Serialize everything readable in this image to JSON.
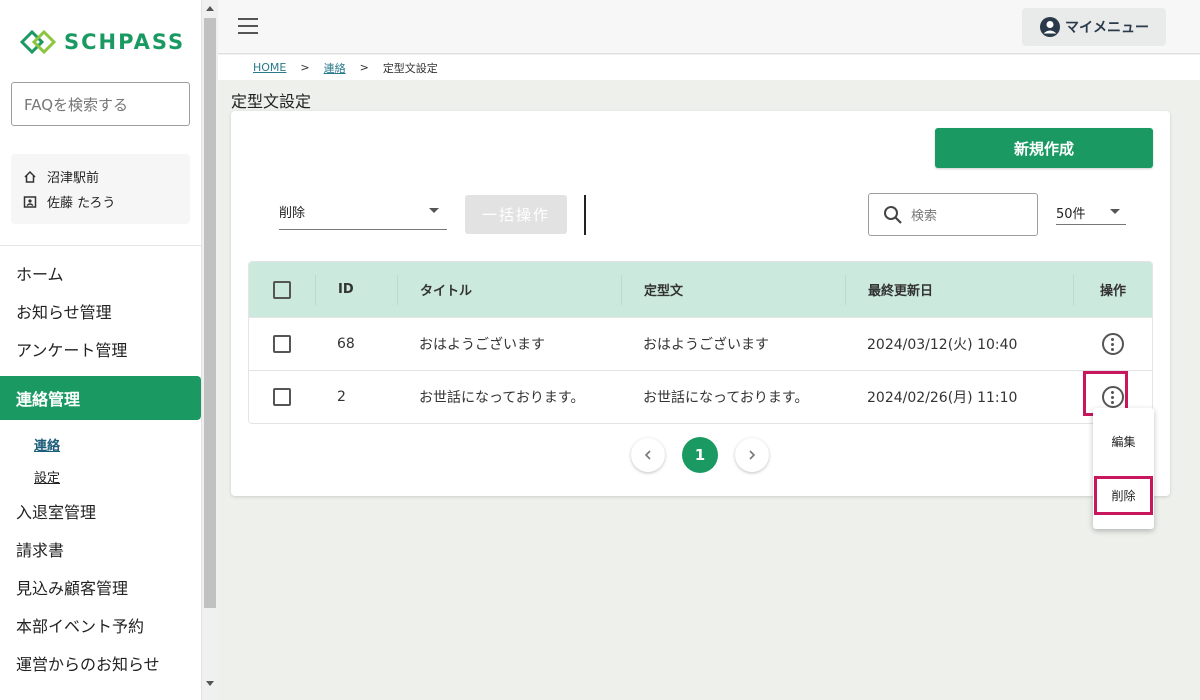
{
  "sidebar": {
    "logo_text": "SCHPASS",
    "faq_placeholder": "FAQを検索する",
    "school": "沼津駅前",
    "user": "佐藤 たろう",
    "nav": [
      {
        "label": "ホーム"
      },
      {
        "label": "お知らせ管理"
      },
      {
        "label": "アンケート管理"
      },
      {
        "label": "連絡管理"
      },
      {
        "label": "入退室管理"
      },
      {
        "label": "請求書"
      },
      {
        "label": "見込み顧客管理"
      },
      {
        "label": "本部イベント予約"
      },
      {
        "label": "運営からのお知らせ"
      }
    ],
    "sub": [
      {
        "label": "連絡"
      },
      {
        "label": "設定"
      }
    ]
  },
  "header": {
    "my_menu": "マイメニュー"
  },
  "breadcrumb": {
    "home": "HOME",
    "parent": "連絡",
    "sep": ">",
    "current": "定型文設定"
  },
  "page_title": "定型文設定",
  "toolbar": {
    "new_button": "新規作成",
    "bulk_action_value": "削除",
    "bulk_button": "一括操作",
    "search_placeholder": "検索",
    "per_page": "50件"
  },
  "table": {
    "headers": {
      "id": "ID",
      "title": "タイトル",
      "body": "定型文",
      "updated": "最終更新日",
      "actions": "操作"
    },
    "rows": [
      {
        "id": "68",
        "title": "おはようございます",
        "body": "おはようございます",
        "updated": "2024/03/12(火) 10:40"
      },
      {
        "id": "2",
        "title": "お世話になっております。",
        "body": "お世話になっております。",
        "updated": "2024/02/26(月) 11:10"
      }
    ]
  },
  "pagination": {
    "current": "1"
  },
  "popup_menu": {
    "edit": "編集",
    "delete": "削除"
  },
  "colors": {
    "brand": "#1a9a62",
    "header_row": "#cce9de",
    "highlight": "#c8175d"
  }
}
